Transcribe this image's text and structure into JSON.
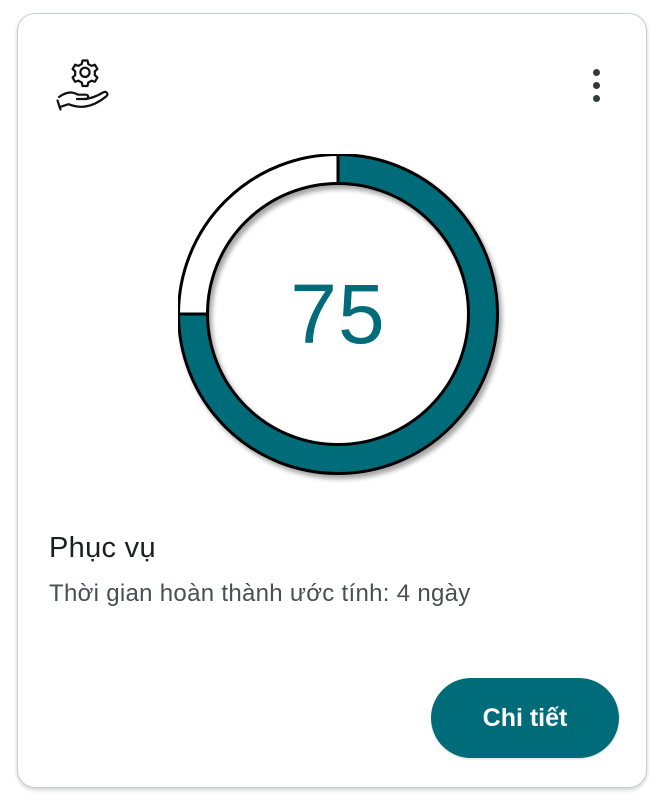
{
  "card": {
    "icon": "gear-hand-service-icon",
    "menu_icon": "more-vertical-icon",
    "gauge": {
      "value": 75,
      "value_label": "75",
      "max": 100,
      "fill_color": "#006c79",
      "track_color": "#ffffff",
      "outline_color": "#000000"
    },
    "title": "Phục vụ",
    "subtitle": "Thời gian hoàn thành ước tính: 4 ngày",
    "details_button_label": "Chi tiết",
    "accent_color": "#006c79"
  }
}
